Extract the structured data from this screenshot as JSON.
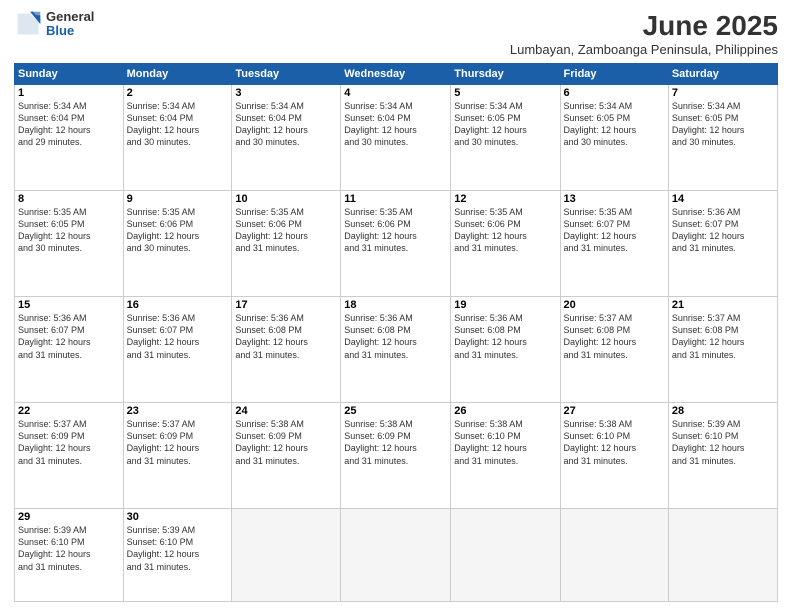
{
  "header": {
    "logo_general": "General",
    "logo_blue": "Blue",
    "month_title": "June 2025",
    "location": "Lumbayan, Zamboanga Peninsula, Philippines"
  },
  "weekdays": [
    "Sunday",
    "Monday",
    "Tuesday",
    "Wednesday",
    "Thursday",
    "Friday",
    "Saturday"
  ],
  "weeks": [
    [
      {
        "day": "1",
        "sunrise": "5:34 AM",
        "sunset": "6:04 PM",
        "daylight": "12 hours and 29 minutes."
      },
      {
        "day": "2",
        "sunrise": "5:34 AM",
        "sunset": "6:04 PM",
        "daylight": "12 hours and 30 minutes."
      },
      {
        "day": "3",
        "sunrise": "5:34 AM",
        "sunset": "6:04 PM",
        "daylight": "12 hours and 30 minutes."
      },
      {
        "day": "4",
        "sunrise": "5:34 AM",
        "sunset": "6:04 PM",
        "daylight": "12 hours and 30 minutes."
      },
      {
        "day": "5",
        "sunrise": "5:34 AM",
        "sunset": "6:05 PM",
        "daylight": "12 hours and 30 minutes."
      },
      {
        "day": "6",
        "sunrise": "5:34 AM",
        "sunset": "6:05 PM",
        "daylight": "12 hours and 30 minutes."
      },
      {
        "day": "7",
        "sunrise": "5:34 AM",
        "sunset": "6:05 PM",
        "daylight": "12 hours and 30 minutes."
      }
    ],
    [
      {
        "day": "8",
        "sunrise": "5:35 AM",
        "sunset": "6:05 PM",
        "daylight": "12 hours and 30 minutes."
      },
      {
        "day": "9",
        "sunrise": "5:35 AM",
        "sunset": "6:06 PM",
        "daylight": "12 hours and 30 minutes."
      },
      {
        "day": "10",
        "sunrise": "5:35 AM",
        "sunset": "6:06 PM",
        "daylight": "12 hours and 31 minutes."
      },
      {
        "day": "11",
        "sunrise": "5:35 AM",
        "sunset": "6:06 PM",
        "daylight": "12 hours and 31 minutes."
      },
      {
        "day": "12",
        "sunrise": "5:35 AM",
        "sunset": "6:06 PM",
        "daylight": "12 hours and 31 minutes."
      },
      {
        "day": "13",
        "sunrise": "5:35 AM",
        "sunset": "6:07 PM",
        "daylight": "12 hours and 31 minutes."
      },
      {
        "day": "14",
        "sunrise": "5:36 AM",
        "sunset": "6:07 PM",
        "daylight": "12 hours and 31 minutes."
      }
    ],
    [
      {
        "day": "15",
        "sunrise": "5:36 AM",
        "sunset": "6:07 PM",
        "daylight": "12 hours and 31 minutes."
      },
      {
        "day": "16",
        "sunrise": "5:36 AM",
        "sunset": "6:07 PM",
        "daylight": "12 hours and 31 minutes."
      },
      {
        "day": "17",
        "sunrise": "5:36 AM",
        "sunset": "6:08 PM",
        "daylight": "12 hours and 31 minutes."
      },
      {
        "day": "18",
        "sunrise": "5:36 AM",
        "sunset": "6:08 PM",
        "daylight": "12 hours and 31 minutes."
      },
      {
        "day": "19",
        "sunrise": "5:36 AM",
        "sunset": "6:08 PM",
        "daylight": "12 hours and 31 minutes."
      },
      {
        "day": "20",
        "sunrise": "5:37 AM",
        "sunset": "6:08 PM",
        "daylight": "12 hours and 31 minutes."
      },
      {
        "day": "21",
        "sunrise": "5:37 AM",
        "sunset": "6:08 PM",
        "daylight": "12 hours and 31 minutes."
      }
    ],
    [
      {
        "day": "22",
        "sunrise": "5:37 AM",
        "sunset": "6:09 PM",
        "daylight": "12 hours and 31 minutes."
      },
      {
        "day": "23",
        "sunrise": "5:37 AM",
        "sunset": "6:09 PM",
        "daylight": "12 hours and 31 minutes."
      },
      {
        "day": "24",
        "sunrise": "5:38 AM",
        "sunset": "6:09 PM",
        "daylight": "12 hours and 31 minutes."
      },
      {
        "day": "25",
        "sunrise": "5:38 AM",
        "sunset": "6:09 PM",
        "daylight": "12 hours and 31 minutes."
      },
      {
        "day": "26",
        "sunrise": "5:38 AM",
        "sunset": "6:10 PM",
        "daylight": "12 hours and 31 minutes."
      },
      {
        "day": "27",
        "sunrise": "5:38 AM",
        "sunset": "6:10 PM",
        "daylight": "12 hours and 31 minutes."
      },
      {
        "day": "28",
        "sunrise": "5:39 AM",
        "sunset": "6:10 PM",
        "daylight": "12 hours and 31 minutes."
      }
    ],
    [
      {
        "day": "29",
        "sunrise": "5:39 AM",
        "sunset": "6:10 PM",
        "daylight": "12 hours and 31 minutes."
      },
      {
        "day": "30",
        "sunrise": "5:39 AM",
        "sunset": "6:10 PM",
        "daylight": "12 hours and 31 minutes."
      },
      null,
      null,
      null,
      null,
      null
    ]
  ],
  "labels": {
    "sunrise": "Sunrise:",
    "sunset": "Sunset:",
    "daylight": "Daylight:"
  }
}
